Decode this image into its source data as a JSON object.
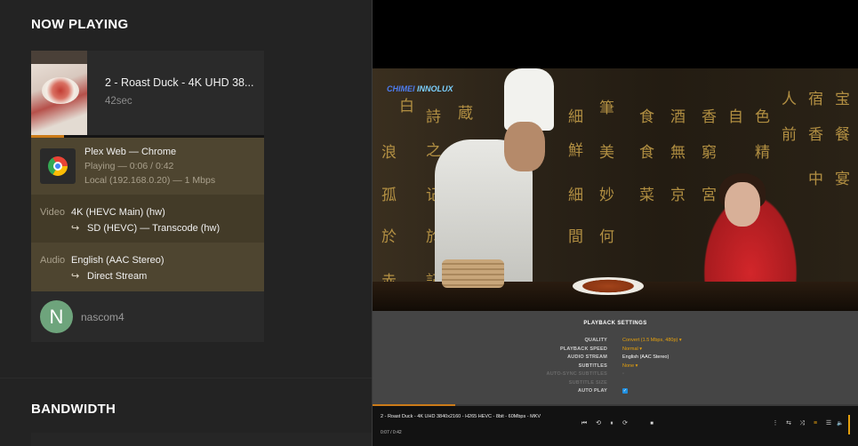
{
  "dashboard": {
    "now_playing_heading": "NOW PLAYING",
    "bandwidth_heading": "BANDWIDTH",
    "session": {
      "title": "2 - Roast Duck - 4K UHD 38...",
      "duration": "42sec",
      "progress_fraction": 0.14,
      "player_line": "Plex Web  —  Chrome",
      "state_line": "Playing — 0:06 / 0:42",
      "location_line": "Local (192.168.0.20) — 1 Mbps",
      "video_label": "Video",
      "video_value": "4K (HEVC Main) (hw)",
      "video_transcode": "SD (HEVC) — Transcode (hw)",
      "audio_label": "Audio",
      "audio_value": "English (AAC Stereo)",
      "audio_stream": "Direct Stream",
      "arrow_glyph": "↪",
      "user_initial": "N",
      "username": "nascom4",
      "avatar_color": "#6ea47c"
    }
  },
  "player": {
    "brand_part1": "CHIMEI ",
    "brand_part2": "INNOLUX",
    "settings_title": "PLAYBACK SETTINGS",
    "settings": [
      {
        "label": "QUALITY",
        "value": "Convert (1.5 Mbps, 480p) ▾",
        "style": "orange"
      },
      {
        "label": "PLAYBACK SPEED",
        "value": "Normal ▾",
        "style": "orange"
      },
      {
        "label": "AUDIO STREAM",
        "value": "English (AAC Stereo)",
        "style": "white"
      },
      {
        "label": "SUBTITLES",
        "value": "None ▾",
        "style": "orange"
      },
      {
        "label": "AUTO-SYNC SUBTITLES",
        "value": "▫",
        "style": "dim"
      },
      {
        "label": "SUBTITLE SIZE",
        "value": "",
        "style": "dim"
      },
      {
        "label": "AUTO PLAY",
        "value": "✓",
        "style": "checkbox"
      }
    ],
    "now_title": "2 - Roast Duck - 4K UHD 3840x2160 - H265 HEVC - 8bit - 60Mbps - MKV",
    "time": "0:07 / 0:42",
    "progress_fraction": 0.17,
    "accent": "#e5a00d",
    "icons": {
      "prev": "⏮",
      "replay": "⟲",
      "pause": "⏸",
      "forward": "⟳",
      "stop": "■",
      "more": "⋮",
      "repeat": "⇆",
      "shuffle": "⤨",
      "equalizer": "≡",
      "playlist": "☰",
      "volume": "🔈"
    }
  }
}
